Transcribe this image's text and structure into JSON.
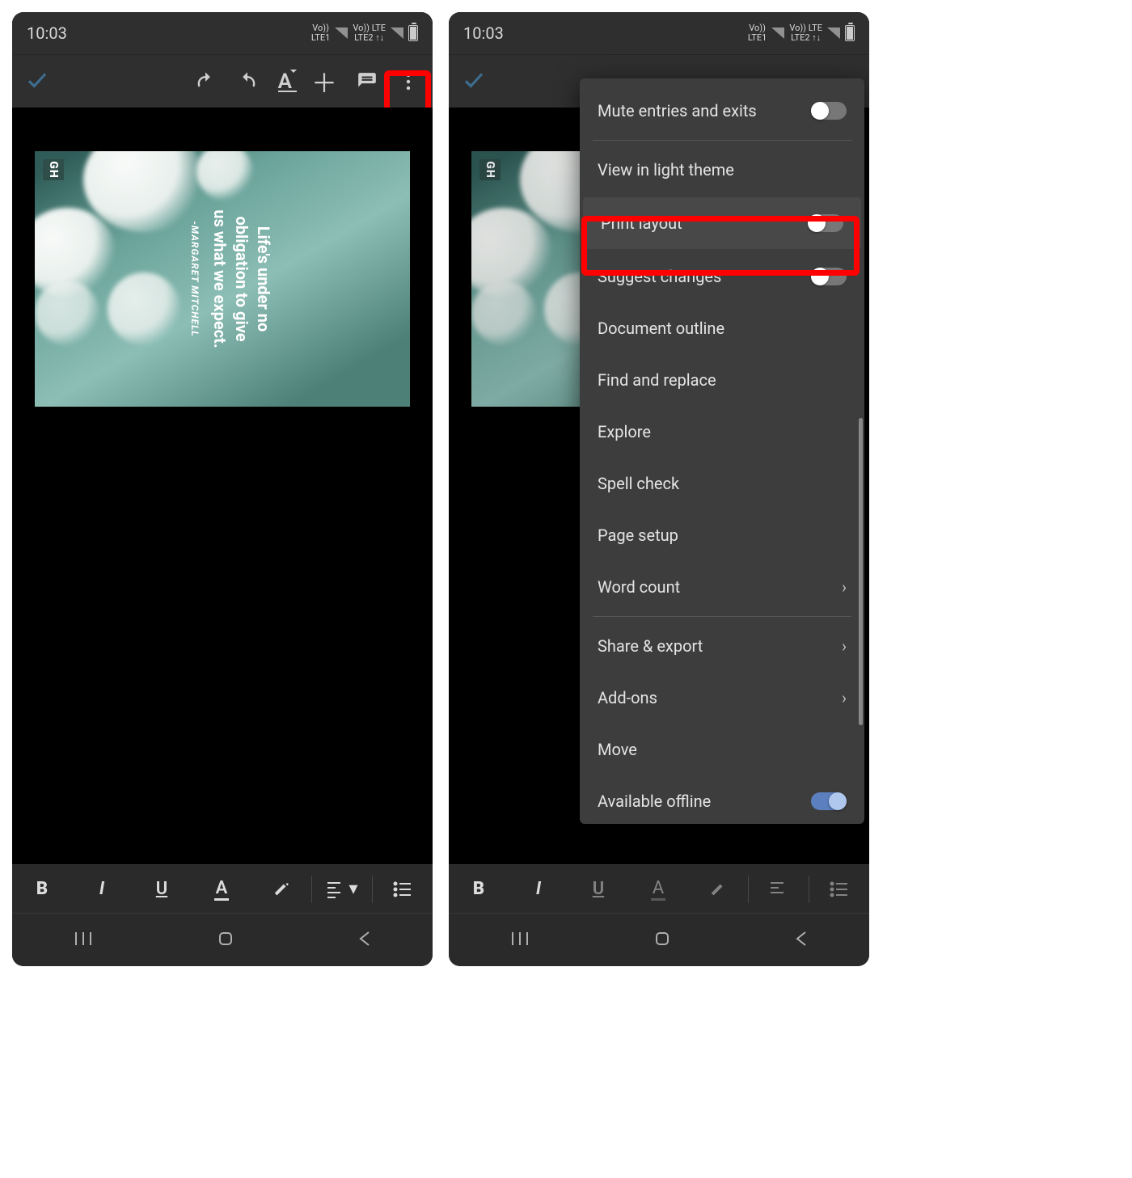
{
  "status": {
    "time": "10:03",
    "net1": "Vo)) LTE1",
    "net2": "Vo)) LTE  LTE2 ↑↓"
  },
  "toolbar": {
    "check": "✓",
    "undo": "undo",
    "redo": "redo",
    "textformat": "A",
    "add": "＋",
    "comment": "comment",
    "more": "⋮"
  },
  "quote": {
    "badge": "GH",
    "line1": "Life's under no",
    "line2": "obligation to give",
    "line3": "us what we expect.",
    "author": "-MARGARET MITCHELL"
  },
  "format": {
    "bold": "B",
    "italic": "I",
    "underline": "U",
    "textcolor": "A",
    "highlight": "hl",
    "align": "align",
    "list": "list"
  },
  "menu": {
    "mute": "Mute entries and exits",
    "lighttheme": "View in light theme",
    "printlayout": "Print layout",
    "suggest": "Suggest changes",
    "outline": "Document outline",
    "findreplace": "Find and replace",
    "explore": "Explore",
    "spellcheck": "Spell check",
    "pagesetup": "Page setup",
    "wordcount": "Word count",
    "shareexport": "Share & export",
    "addons": "Add-ons",
    "move": "Move",
    "offline": "Available offline"
  }
}
